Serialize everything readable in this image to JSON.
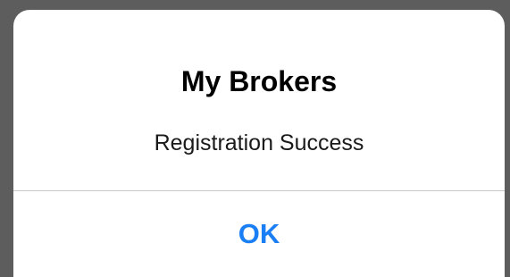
{
  "dialog": {
    "title": "My Brokers",
    "message": "Registration Success",
    "ok_label": "OK"
  },
  "colors": {
    "backdrop": "#5d5d5d",
    "dialog_background": "#ffffff",
    "accent": "#1a7ff5",
    "divider": "#c8c8c8"
  }
}
